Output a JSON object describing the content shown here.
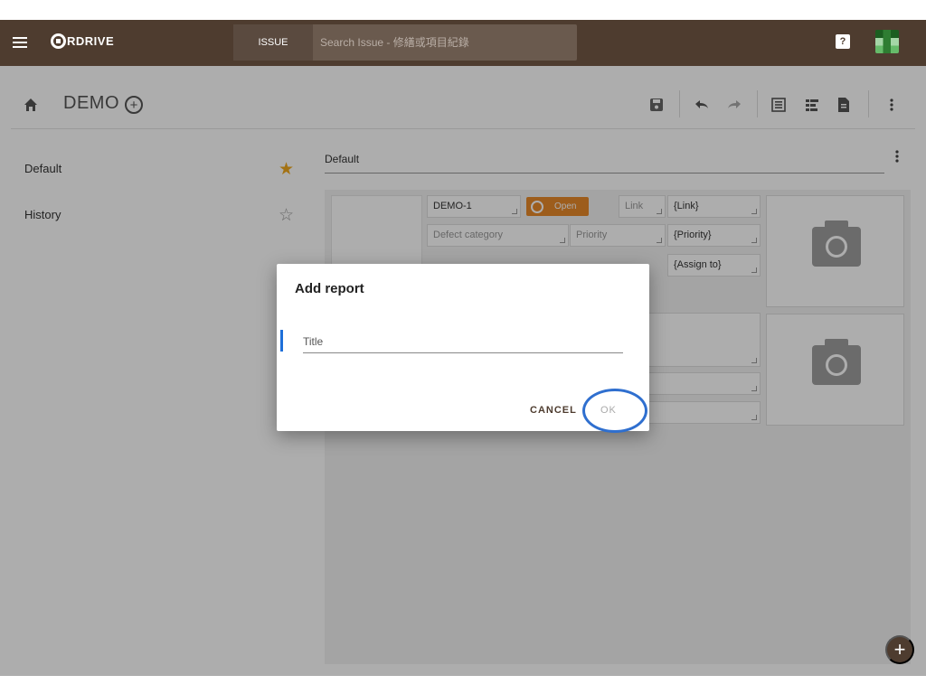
{
  "appbar": {
    "logo_text": "RDRIVE",
    "search_type": "ISSUE",
    "search_placeholder": "Search Issue - 修繕或項目紀錄",
    "help_label": "?"
  },
  "toolbar": {
    "title": "DEMO",
    "add_label": "+"
  },
  "sidebar": {
    "items": [
      {
        "label": "Default",
        "starred": true
      },
      {
        "label": "History",
        "starred": false
      }
    ],
    "star_filled": "★",
    "star_empty": "☆"
  },
  "main": {
    "field_value": "Default",
    "cells": {
      "id": "DEMO-1",
      "status": "Open",
      "link_label": "Link",
      "link_value": "{Link}",
      "category_label": "Defect category",
      "priority_label": "Priority",
      "priority_value": "{Priority}",
      "assign_value": "{Assign to}"
    }
  },
  "dialog": {
    "title": "Add report",
    "input_placeholder": "Title",
    "input_value": "",
    "cancel_label": "CANCEL",
    "ok_label": "OK"
  },
  "fab_label": "+",
  "colors": {
    "appbar": "#4e3c2f",
    "accent_orange": "#e8892a",
    "star_gold": "#f0a81c",
    "focus_blue": "#1e6fd9"
  }
}
